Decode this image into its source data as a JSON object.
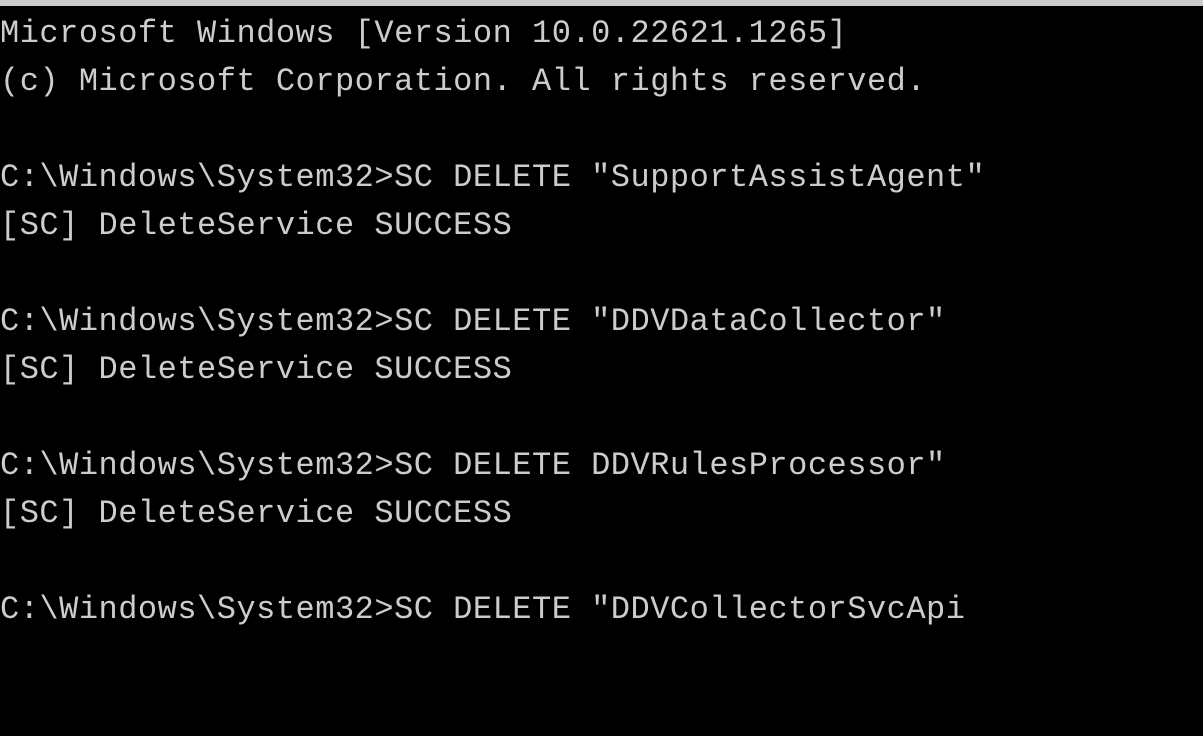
{
  "terminal": {
    "header_line1": "Microsoft Windows [Version 10.0.22621.1265]",
    "header_line2": "(c) Microsoft Corporation. All rights reserved.",
    "prompt": "C:\\Windows\\System32>",
    "commands": [
      {
        "full_line": "C:\\Windows\\System32>SC DELETE \"SupportAssistAgent\"",
        "response": "[SC] DeleteService SUCCESS"
      },
      {
        "full_line": "C:\\Windows\\System32>SC DELETE \"DDVDataCollector\"",
        "response": "[SC] DeleteService SUCCESS"
      },
      {
        "full_line": "C:\\Windows\\System32>SC DELETE DDVRulesProcessor\"",
        "response": "[SC] DeleteService SUCCESS"
      },
      {
        "full_line": "C:\\Windows\\System32>SC DELETE \"DDVCollectorSvcApi",
        "response": ""
      }
    ]
  }
}
